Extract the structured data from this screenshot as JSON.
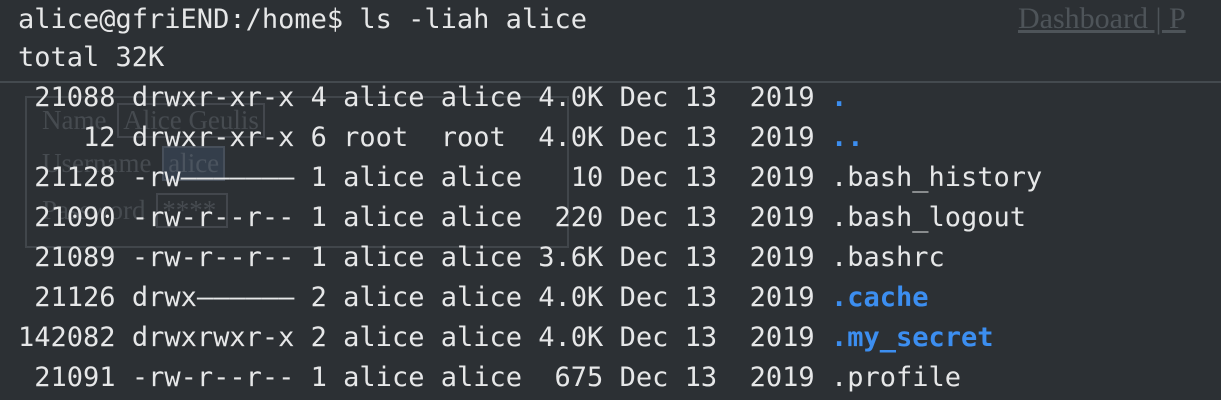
{
  "background_page": {
    "nav_text": "Dashboard | P",
    "form_rows": [
      {
        "label": "Name",
        "value": "Alice Geulis"
      },
      {
        "label": "Username",
        "value": "alice"
      },
      {
        "label": "Password",
        "value": "****"
      }
    ]
  },
  "terminal": {
    "prompt": "alice@gfriEND:/home$",
    "command": "ls -liah alice",
    "total": "total 32K",
    "entries": [
      {
        "inode": "21088",
        "perms": "drwxr-xr-x",
        "links": "4",
        "owner": "alice",
        "group": "alice",
        "size": "4.0K",
        "month": "Dec",
        "day": "13",
        "year": "2019",
        "name": ".",
        "type": "directory"
      },
      {
        "inode": "12",
        "perms": "drwxr-xr-x",
        "links": "6",
        "owner": "root",
        "group": "root",
        "size": "4.0K",
        "month": "Dec",
        "day": "13",
        "year": "2019",
        "name": "..",
        "type": "directory"
      },
      {
        "inode": "21128",
        "perms": "-rw———————",
        "links": "1",
        "owner": "alice",
        "group": "alice",
        "size": "10",
        "month": "Dec",
        "day": "13",
        "year": "2019",
        "name": ".bash_history",
        "type": "file"
      },
      {
        "inode": "21090",
        "perms": "-rw-r--r--",
        "links": "1",
        "owner": "alice",
        "group": "alice",
        "size": "220",
        "month": "Dec",
        "day": "13",
        "year": "2019",
        "name": ".bash_logout",
        "type": "file"
      },
      {
        "inode": "21089",
        "perms": "-rw-r--r--",
        "links": "1",
        "owner": "alice",
        "group": "alice",
        "size": "3.6K",
        "month": "Dec",
        "day": "13",
        "year": "2019",
        "name": ".bashrc",
        "type": "file"
      },
      {
        "inode": "21126",
        "perms": "drwx——————",
        "links": "2",
        "owner": "alice",
        "group": "alice",
        "size": "4.0K",
        "month": "Dec",
        "day": "13",
        "year": "2019",
        "name": ".cache",
        "type": "directory"
      },
      {
        "inode": "142082",
        "perms": "drwxrwxr-x",
        "links": "2",
        "owner": "alice",
        "group": "alice",
        "size": "4.0K",
        "month": "Dec",
        "day": "13",
        "year": "2019",
        "name": ".my_secret",
        "type": "directory"
      },
      {
        "inode": "21091",
        "perms": "-rw-r--r--",
        "links": "1",
        "owner": "alice",
        "group": "alice",
        "size": "675",
        "month": "Dec",
        "day": "13",
        "year": "2019",
        "name": ".profile",
        "type": "file"
      }
    ]
  },
  "colors": {
    "background": "#2c3034",
    "text": "#e6e7e8",
    "directory": "#3c8ef0"
  }
}
